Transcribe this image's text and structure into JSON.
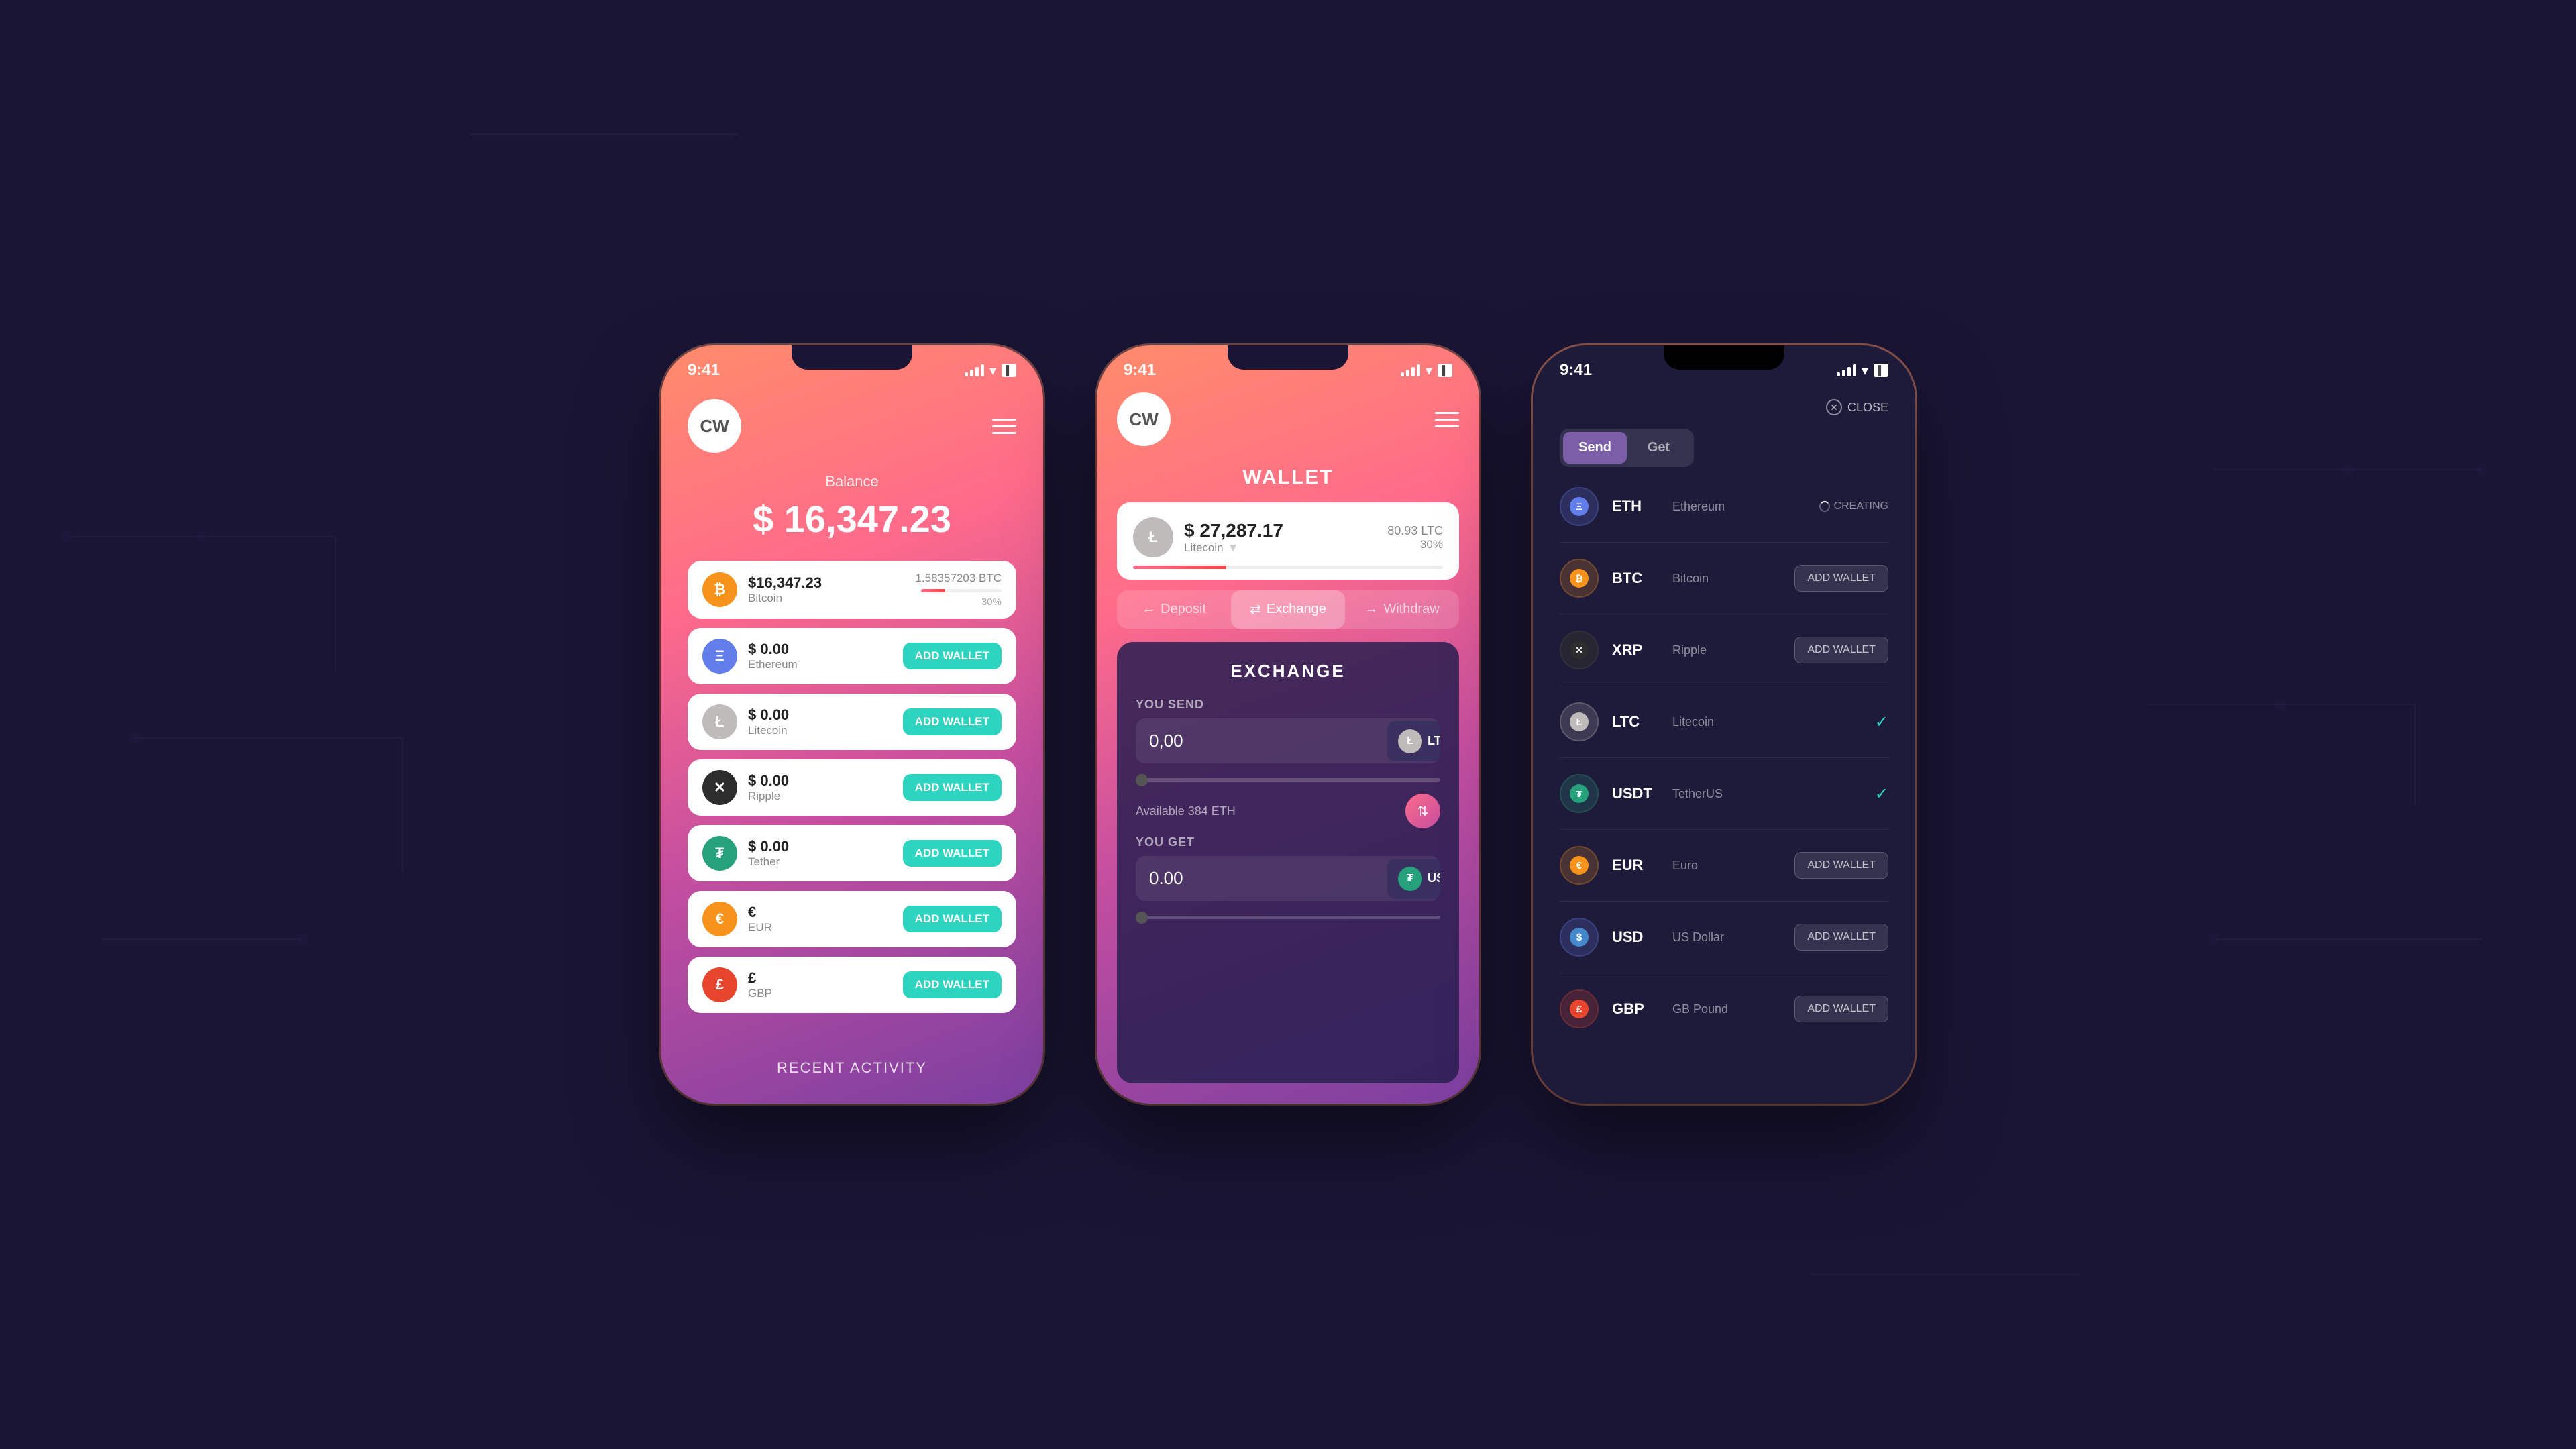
{
  "background": {
    "color": "#1a1535"
  },
  "phone1": {
    "status_time": "9:41",
    "header": {
      "logo": "CW",
      "menu_label": "menu"
    },
    "balance": {
      "label": "Balance",
      "amount": "$ 16,347.23"
    },
    "wallets": [
      {
        "ticker": "BTC",
        "name": "Bitcoin",
        "amount": "$16,347.23",
        "btc_amount": "1.58357203 BTC",
        "progress": 30,
        "progress_text": "30%",
        "has_wallet": true,
        "color": "coin-btc",
        "symbol": "₿"
      },
      {
        "ticker": "ETH",
        "name": "Ethereum",
        "amount": "$ 0.00",
        "has_wallet": false,
        "color": "coin-eth",
        "symbol": "Ξ"
      },
      {
        "ticker": "LTC",
        "name": "Litecoin",
        "amount": "$ 0.00",
        "has_wallet": false,
        "color": "coin-ltc",
        "symbol": "Ł"
      },
      {
        "ticker": "XRP",
        "name": "Ripple",
        "amount": "$ 0.00",
        "has_wallet": false,
        "color": "coin-xrp",
        "symbol": "✕"
      },
      {
        "ticker": "USDT",
        "name": "Tether",
        "amount": "$ 0.00",
        "has_wallet": false,
        "color": "coin-usdt",
        "symbol": "₮"
      },
      {
        "ticker": "EUR",
        "name": "EUR",
        "amount": "€",
        "has_wallet": false,
        "color": "coin-eur",
        "symbol": "€"
      },
      {
        "ticker": "GBP",
        "name": "GBP",
        "amount": "£",
        "has_wallet": false,
        "color": "coin-gbp",
        "symbol": "£"
      }
    ],
    "recent_activity_label": "RECENT ACTIVITY",
    "add_wallet_label": "ADD WALLET"
  },
  "phone2": {
    "status_time": "9:41",
    "header": {
      "logo": "CW",
      "menu_label": "menu"
    },
    "title": "WALLET",
    "balance_card": {
      "usd": "$ 27,287.17",
      "coin_name": "Litecoin",
      "ltc_amount": "80.93 LTC",
      "progress": 30,
      "progress_text": "30%"
    },
    "tabs": [
      {
        "label": "← Deposit",
        "active": false
      },
      {
        "label": "⇄ Exchange",
        "active": true
      },
      {
        "label": "→ Withdraw",
        "active": false
      }
    ],
    "exchange": {
      "title": "EXCHANGE",
      "send_label": "YOU SEND",
      "send_value": "0,00",
      "send_coin": "LTC",
      "available_label": "Available 384 ETH",
      "get_label": "YOU GET",
      "get_value": "0.00",
      "get_coin": "USDT"
    }
  },
  "phone3": {
    "status_time": "9:41",
    "close_label": "CLOSE",
    "send_label": "Send",
    "get_label": "Get",
    "coins": [
      {
        "ticker": "ETH",
        "name": "Ethereum",
        "action": "creating",
        "action_label": "CREATING",
        "color": "coin-eth",
        "symbol": "Ξ"
      },
      {
        "ticker": "BTC",
        "name": "Bitcoin",
        "action": "add",
        "action_label": "ADD WALLET",
        "color": "coin-btc",
        "symbol": "₿"
      },
      {
        "ticker": "XRP",
        "name": "Ripple",
        "action": "add",
        "action_label": "ADD WALLET",
        "color": "coin-xrp",
        "symbol": "✕"
      },
      {
        "ticker": "LTC",
        "name": "Litecoin",
        "action": "check",
        "action_label": "✓",
        "color": "coin-ltc",
        "symbol": "Ł"
      },
      {
        "ticker": "USDT",
        "name": "TetherUS",
        "action": "check",
        "action_label": "✓",
        "color": "coin-usdt",
        "symbol": "₮"
      },
      {
        "ticker": "EUR",
        "name": "Euro",
        "action": "add",
        "action_label": "ADD WALLET",
        "color": "coin-eur",
        "symbol": "€"
      },
      {
        "ticker": "USD",
        "name": "US Dollar",
        "action": "add",
        "action_label": "ADD WALLET",
        "color": "coin-eth",
        "symbol": "$"
      },
      {
        "ticker": "GBP",
        "name": "GB Pound",
        "action": "add",
        "action_label": "ADD WALLET",
        "color": "coin-gbp",
        "symbol": "£"
      }
    ]
  }
}
